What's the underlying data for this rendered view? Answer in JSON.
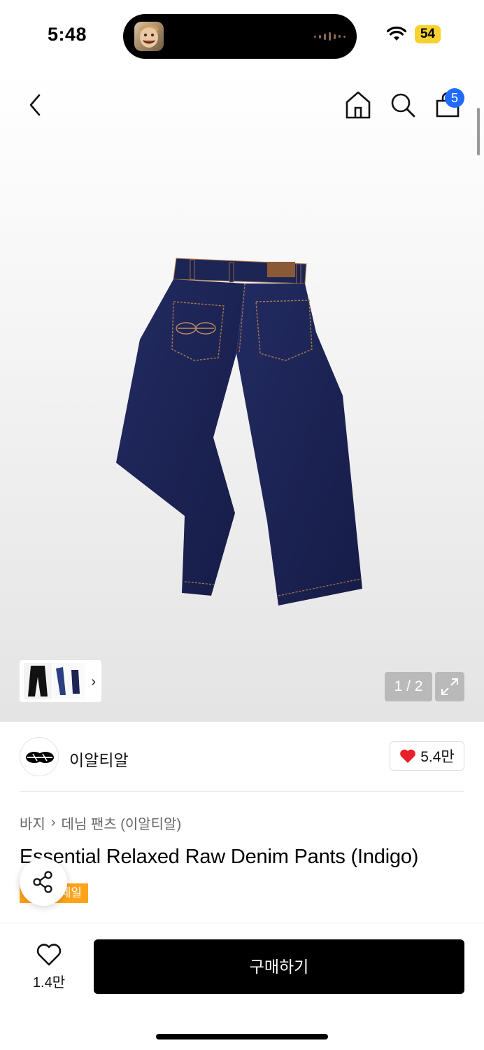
{
  "status": {
    "time": "5:48",
    "battery": "54",
    "icons": [
      "wifi-icon",
      "battery-icon"
    ]
  },
  "nav": {
    "icons": [
      "back-icon",
      "home-icon",
      "search-icon",
      "bag-icon"
    ],
    "bag_count": "5"
  },
  "gallery": {
    "counter": "1 / 2",
    "expand_icon": "expand-icon",
    "thumb_chevron": "›"
  },
  "brand": {
    "name": "이알티알",
    "likes": "5.4만"
  },
  "breadcrumb": {
    "category": "바지",
    "separator": "›",
    "subcategory": "데님 팬츠 (이알티알)"
  },
  "product": {
    "title": "Essential Relaxed Raw Denim Pants (Indigo)",
    "sale_tag": "세일"
  },
  "bottom": {
    "wish_count": "1.4만",
    "buy_label": "구매하기"
  },
  "colors": {
    "badge_blue": "#1f6bff",
    "sale_orange": "#ffa31a",
    "heart_red": "#e8202a",
    "denim": "#1d2555"
  }
}
